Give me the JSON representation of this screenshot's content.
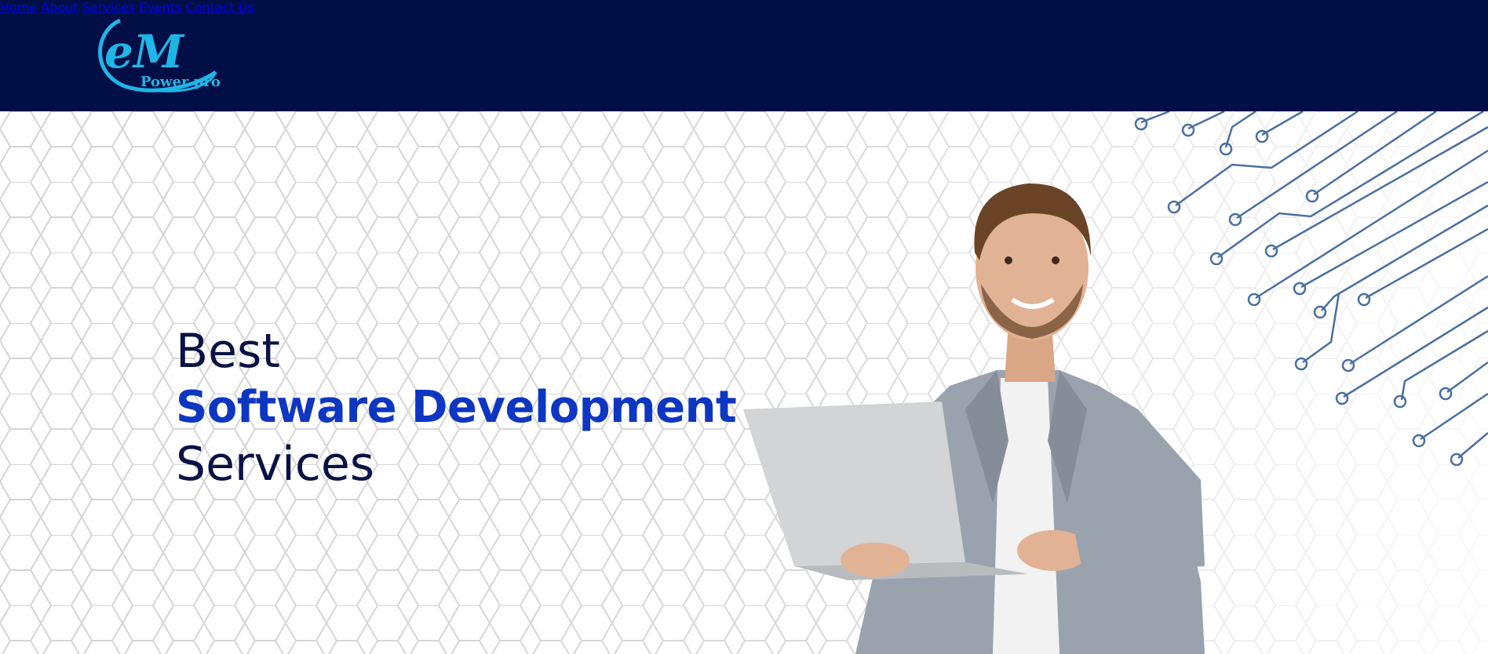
{
  "brand": {
    "logo_text_main": "eM",
    "logo_text_sub": "Power pro"
  },
  "nav": {
    "items": [
      "Home",
      "About",
      "Services",
      "Events",
      "Contact Us"
    ]
  },
  "hero": {
    "line1": "Best",
    "line2": "Software Development",
    "line3": "Services"
  },
  "colors": {
    "header_bg": "#020f46",
    "accent": "#0d36c2",
    "text_dark": "#0a1245",
    "logo_cyan": "#1fb5e6",
    "circuit_line": "#4a6fa0"
  }
}
